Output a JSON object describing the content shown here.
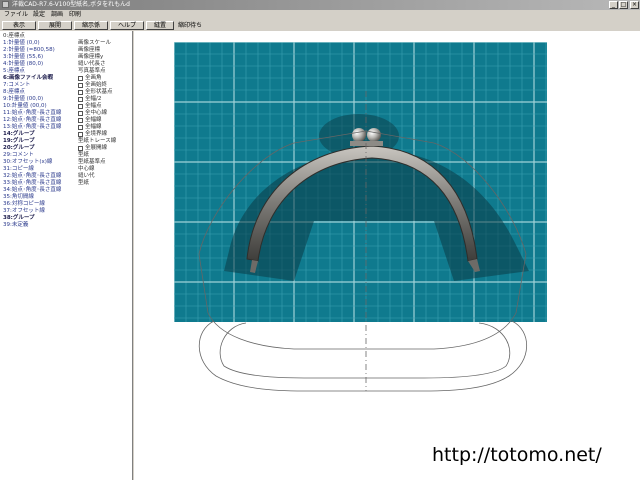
{
  "window": {
    "title": "洋裁CAD-R7.6-V100型紙名,ボタをれもんd",
    "buttons": [
      "_",
      "□",
      "×"
    ]
  },
  "menu": [
    "ファイル",
    "設定",
    "調画",
    "印刷"
  ],
  "toolbar": {
    "buttons": [
      "表示",
      "展開",
      "縮示係",
      "ヘルプ",
      "縫置"
    ],
    "label": "縮印待ち"
  },
  "layers": [
    {
      "label": "0:座標点",
      "style": "dark"
    },
    {
      "label": "1:計量値 (0,0)",
      "style": ""
    },
    {
      "label": "2:計量値 (=800,58)",
      "style": ""
    },
    {
      "label": "3:計量値 (55,6)",
      "style": ""
    },
    {
      "label": "4:計量値 (80,0)",
      "style": ""
    },
    {
      "label": "5:座標点",
      "style": ""
    },
    {
      "label": "6:画像ファイル会暇",
      "style": "bold"
    },
    {
      "label": "7:コメント",
      "style": ""
    },
    {
      "label": "8:座標点",
      "style": ""
    },
    {
      "label": "9:計量値 (00,0)",
      "style": ""
    },
    {
      "label": "10:計量値 (00,0)",
      "style": ""
    },
    {
      "label": "11:始点･角度･長さ直線",
      "style": ""
    },
    {
      "label": "12:始点･角度･長さ直線",
      "style": ""
    },
    {
      "label": "13:始点･角度･長さ直線",
      "style": ""
    },
    {
      "label": "14:グループ",
      "style": "bold"
    },
    {
      "label": "19:グループ",
      "style": "bold"
    },
    {
      "label": "20:グループ",
      "style": "bold"
    },
    {
      "label": "29:コメント",
      "style": ""
    },
    {
      "label": "30:オフセット(x)線",
      "style": ""
    },
    {
      "label": "31:コピー線",
      "style": ""
    },
    {
      "label": "32:始点･角度･長さ直線",
      "style": ""
    },
    {
      "label": "33:始点･角度･長さ直線",
      "style": ""
    },
    {
      "label": "34:始点･角度･長さ直線",
      "style": ""
    },
    {
      "label": "35:角切間線",
      "style": ""
    },
    {
      "label": "36:対称コピー線",
      "style": ""
    },
    {
      "label": "37:オフセット線",
      "style": ""
    },
    {
      "label": "38:グループ",
      "style": "bold"
    },
    {
      "label": "39:未定義",
      "style": ""
    }
  ],
  "layer_props": [
    {
      "label": "画像スケール",
      "check": false
    },
    {
      "label": "画像座標",
      "check": false
    },
    {
      "label": "画像座標y",
      "check": false
    },
    {
      "label": "縫い代長さ",
      "check": false
    },
    {
      "label": "写真基準点",
      "check": false
    },
    {
      "label": "全画角",
      "check": true
    },
    {
      "label": "全画始終",
      "check": true
    },
    {
      "label": "全形状基点",
      "check": true
    },
    {
      "label": "全幅/2",
      "check": true
    },
    {
      "label": "全幅点",
      "check": true
    },
    {
      "label": "全中心線",
      "check": true
    },
    {
      "label": "全幅線",
      "check": true
    },
    {
      "label": "全幅線",
      "check": true
    },
    {
      "label": "全境界線",
      "check": true
    },
    {
      "label": "型紙トレース線",
      "check": false
    },
    {
      "label": "全展開線",
      "check": true
    },
    {
      "label": "型紙",
      "check": false
    },
    {
      "label": "型紙基準点",
      "check": false
    },
    {
      "label": "中心線",
      "check": false
    },
    {
      "label": "縫い代",
      "check": false
    },
    {
      "label": "型紙",
      "check": false
    }
  ],
  "canvas": {
    "photo_colors": {
      "base": "#0f7a8e",
      "grid_minor": "#3aa0b2",
      "grid_major": "#9fd2d8"
    },
    "pattern_color": "#666666",
    "url": "http://totomo.net/"
  }
}
